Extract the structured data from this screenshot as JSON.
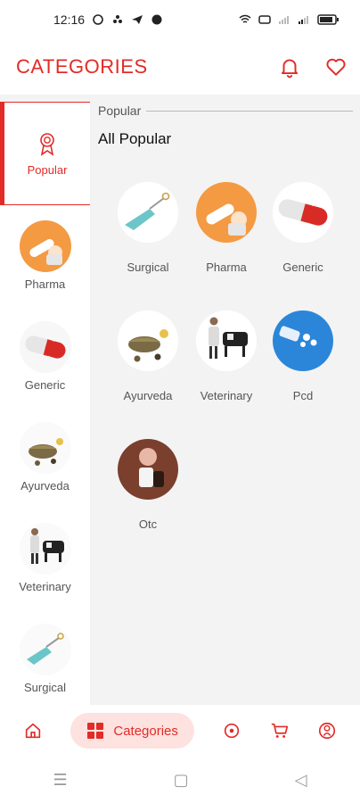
{
  "status_bar": {
    "time": "12:16"
  },
  "header": {
    "title": "CATEGORIES",
    "bell_icon": "bell-icon",
    "heart_icon": "heart-icon"
  },
  "sidebar": {
    "items": [
      {
        "label": "Popular",
        "icon": "award-icon",
        "active": true
      },
      {
        "label": "Pharma",
        "icon": "pharma-image"
      },
      {
        "label": "Generic",
        "icon": "generic-capsule-image"
      },
      {
        "label": "Ayurveda",
        "icon": "ayurveda-image"
      },
      {
        "label": "Veterinary",
        "icon": "veterinary-image"
      },
      {
        "label": "Surgical",
        "icon": "surgical-image"
      }
    ]
  },
  "main": {
    "section_label": "Popular",
    "section_title": "All Popular",
    "tiles": [
      {
        "label": "Surgical"
      },
      {
        "label": "Pharma"
      },
      {
        "label": "Generic"
      },
      {
        "label": "Ayurveda"
      },
      {
        "label": "Veterinary"
      },
      {
        "label": "Pcd"
      },
      {
        "label": "Otc"
      }
    ]
  },
  "bottom_nav": {
    "items": [
      {
        "icon": "home-icon"
      },
      {
        "label": "Categories",
        "icon": "grid-icon",
        "active": true
      },
      {
        "icon": "target-icon"
      },
      {
        "icon": "cart-icon"
      },
      {
        "icon": "profile-icon"
      }
    ]
  },
  "colors": {
    "accent": "#e32b27",
    "active_bg": "#fde2df"
  }
}
